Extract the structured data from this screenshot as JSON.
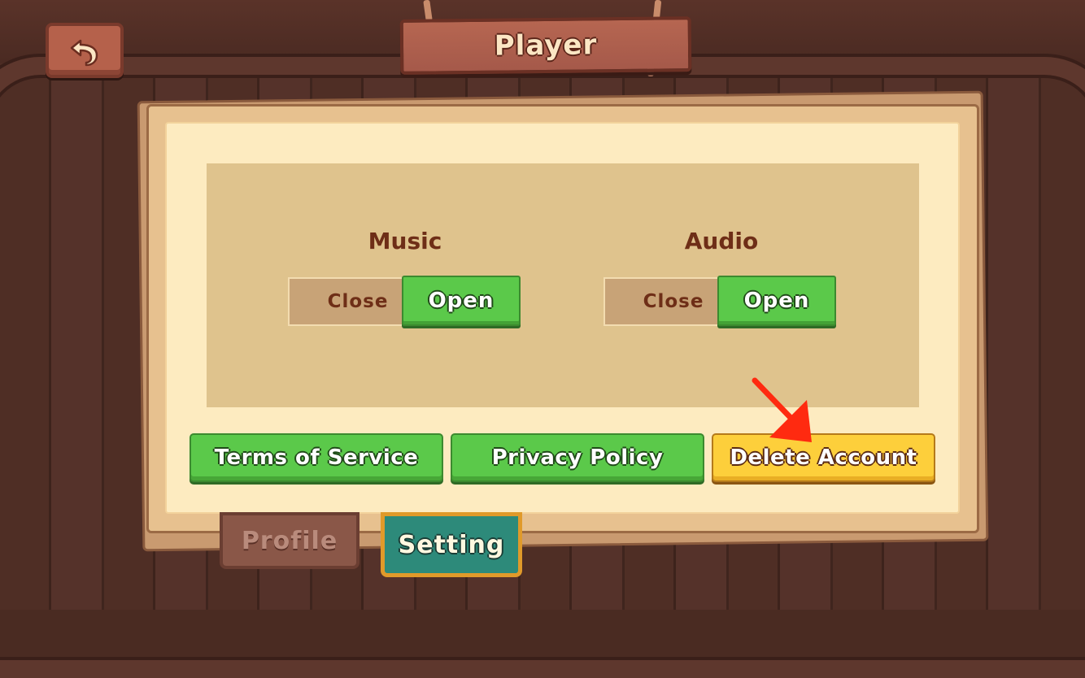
{
  "header": {
    "title": "Player",
    "back_icon": "undo-arrow-icon"
  },
  "settings": {
    "music": {
      "label": "Music",
      "close_label": "Close",
      "open_label": "Open",
      "selected": "Open"
    },
    "audio": {
      "label": "Audio",
      "close_label": "Close",
      "open_label": "Open",
      "selected": "Open"
    }
  },
  "actions": {
    "terms_label": "Terms of Service",
    "privacy_label": "Privacy Policy",
    "delete_label": "Delete Account"
  },
  "tabs": {
    "profile_label": "Profile",
    "setting_label": "Setting",
    "active": "Setting"
  },
  "colors": {
    "green_button": "#5bc94a",
    "yellow_button": "#fdcf3b",
    "annotation_arrow": "#ff2a10",
    "active_tab": "#2d8a7a"
  }
}
